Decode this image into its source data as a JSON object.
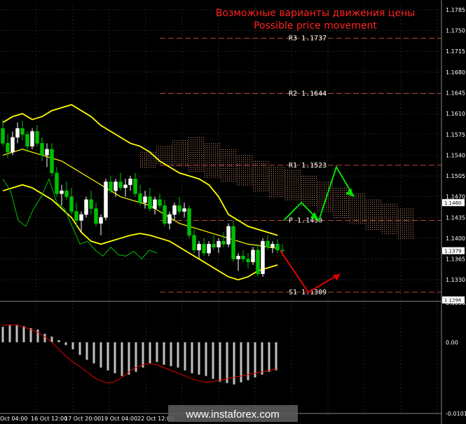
{
  "title_ru": "Возможные варианты движения цены",
  "title_en": "Possible price movement",
  "watermark": "www.instaforex.com",
  "colors": {
    "background": "#000000",
    "grid": "#3a3a3a",
    "level": "#b04a3a",
    "bull": "#ffffff",
    "bear": "#00c000",
    "band": "#ffff00",
    "arrow_up": "#00e000",
    "arrow_down": "#e00000",
    "macd_hist": "#c0c0c0",
    "macd_signal": "#e00000"
  },
  "price_axis": {
    "min": 1.1296,
    "max": 1.1792,
    "ticks": [
      "1.1785",
      "1.1750",
      "1.1715",
      "1.1680",
      "1.1645",
      "1.1610",
      "1.1575",
      "1.1540",
      "1.1505",
      "1.1470",
      "1.1435",
      "1.1400",
      "1.1365",
      "1.1330"
    ],
    "tags": [
      {
        "label": "1.1460",
        "value": 1.146
      },
      {
        "label": "1.1379",
        "value": 1.1379
      },
      {
        "label": "1.1296",
        "value": 1.1296
      }
    ]
  },
  "macd_axis": {
    "min": -0.01013,
    "max": 0.00562,
    "ticks": [
      "0.00562",
      "0.00",
      "-0.01013"
    ]
  },
  "time_axis": [
    "Oct 04:00",
    "16 Oct 12:00",
    "17 Oct 20:00",
    "19 Oct 04:00",
    "22 Oct 12:00"
  ],
  "levels": [
    {
      "label": "R3 1.1737",
      "value": 1.1737
    },
    {
      "label": "R2 1.1644",
      "value": 1.1644
    },
    {
      "label": "R1 1.1523",
      "value": 1.1523
    },
    {
      "label": "P 1.1430",
      "value": 1.143
    },
    {
      "label": "S1 1.1309",
      "value": 1.1309
    }
  ],
  "candles": [
    [
      1.1585,
      1.16,
      1.1555,
      1.156
    ],
    [
      1.156,
      1.1575,
      1.1535,
      1.1545
    ],
    [
      1.1545,
      1.158,
      1.154,
      1.157
    ],
    [
      1.157,
      1.1595,
      1.156,
      1.1585
    ],
    [
      1.1585,
      1.1598,
      1.1565,
      1.1575
    ],
    [
      1.1575,
      1.158,
      1.1545,
      1.1555
    ],
    [
      1.1555,
      1.1585,
      1.155,
      1.158
    ],
    [
      1.158,
      1.159,
      1.1555,
      1.156
    ],
    [
      1.156,
      1.157,
      1.153,
      1.154
    ],
    [
      1.154,
      1.156,
      1.152,
      1.155
    ],
    [
      1.155,
      1.156,
      1.1505,
      1.151
    ],
    [
      1.151,
      1.152,
      1.147,
      1.1475
    ],
    [
      1.1475,
      1.149,
      1.1455,
      1.148
    ],
    [
      1.148,
      1.1495,
      1.1465,
      1.147
    ],
    [
      1.147,
      1.1485,
      1.144,
      1.1445
    ],
    [
      1.1445,
      1.146,
      1.142,
      1.143
    ],
    [
      1.143,
      1.1445,
      1.141,
      1.144
    ],
    [
      1.144,
      1.147,
      1.1435,
      1.1465
    ],
    [
      1.1465,
      1.148,
      1.144,
      1.145
    ],
    [
      1.145,
      1.146,
      1.142,
      1.1425
    ],
    [
      1.1425,
      1.144,
      1.1405,
      1.1435
    ],
    [
      1.1435,
      1.15,
      1.143,
      1.1495
    ],
    [
      1.1495,
      1.1505,
      1.1475,
      1.148
    ],
    [
      1.148,
      1.15,
      1.147,
      1.1495
    ],
    [
      1.1495,
      1.151,
      1.148,
      1.1485
    ],
    [
      1.1485,
      1.15,
      1.147,
      1.149
    ],
    [
      1.149,
      1.1505,
      1.148,
      1.15
    ],
    [
      1.15,
      1.151,
      1.147,
      1.1475
    ],
    [
      1.1475,
      1.149,
      1.1455,
      1.146
    ],
    [
      1.146,
      1.148,
      1.145,
      1.147
    ],
    [
      1.147,
      1.1485,
      1.1445,
      1.145
    ],
    [
      1.145,
      1.147,
      1.144,
      1.1465
    ],
    [
      1.1465,
      1.1475,
      1.145,
      1.1455
    ],
    [
      1.1455,
      1.1465,
      1.142,
      1.1425
    ],
    [
      1.1425,
      1.1445,
      1.1415,
      1.144
    ],
    [
      1.144,
      1.146,
      1.143,
      1.1455
    ],
    [
      1.1455,
      1.147,
      1.144,
      1.1445
    ],
    [
      1.1445,
      1.146,
      1.1435,
      1.145
    ],
    [
      1.145,
      1.1455,
      1.14,
      1.1405
    ],
    [
      1.1405,
      1.1415,
      1.1375,
      1.138
    ],
    [
      1.138,
      1.1395,
      1.1365,
      1.139
    ],
    [
      1.139,
      1.14,
      1.137,
      1.1375
    ],
    [
      1.1375,
      1.1395,
      1.137,
      1.139
    ],
    [
      1.139,
      1.1405,
      1.138,
      1.1385
    ],
    [
      1.1385,
      1.14,
      1.1375,
      1.1395
    ],
    [
      1.1395,
      1.141,
      1.1385,
      1.139
    ],
    [
      1.139,
      1.1425,
      1.1385,
      1.142
    ],
    [
      1.142,
      1.143,
      1.136,
      1.1365
    ],
    [
      1.1365,
      1.1375,
      1.1345,
      1.137
    ],
    [
      1.137,
      1.138,
      1.136,
      1.1365
    ],
    [
      1.1365,
      1.1375,
      1.135,
      1.136
    ],
    [
      1.136,
      1.1385,
      1.1355,
      1.138
    ],
    [
      1.138,
      1.139,
      1.1335,
      1.134
    ],
    [
      1.134,
      1.14,
      1.1335,
      1.1395
    ],
    [
      1.1395,
      1.1405,
      1.138,
      1.1385
    ],
    [
      1.1385,
      1.1395,
      1.1375,
      1.139
    ],
    [
      1.139,
      1.1398,
      1.1375,
      1.138
    ],
    [
      1.138,
      1.139,
      1.137,
      1.1379
    ]
  ],
  "bands": {
    "upper": [
      1.1595,
      1.1605,
      1.161,
      1.16,
      1.1605,
      1.1615,
      1.162,
      1.1625,
      1.1615,
      1.1605,
      1.159,
      1.158,
      1.157,
      1.156,
      1.1555,
      1.1545,
      1.153,
      1.152,
      1.151,
      1.1505,
      1.15,
      1.149,
      1.147,
      1.144,
      1.143,
      1.142,
      1.1415,
      1.141,
      1.1405
    ],
    "mid": [
      1.154,
      1.1545,
      1.155,
      1.1545,
      1.154,
      1.1535,
      1.153,
      1.152,
      1.151,
      1.15,
      1.149,
      1.148,
      1.147,
      1.1465,
      1.146,
      1.1455,
      1.1445,
      1.1435,
      1.1425,
      1.142,
      1.1415,
      1.141,
      1.1405,
      1.14,
      1.1395,
      1.139,
      1.1388,
      1.1385,
      1.1383
    ],
    "lower": [
      1.148,
      1.1485,
      1.149,
      1.1485,
      1.1475,
      1.1465,
      1.145,
      1.1435,
      1.141,
      1.1395,
      1.139,
      1.1395,
      1.14,
      1.1405,
      1.1408,
      1.1405,
      1.14,
      1.1395,
      1.1385,
      1.1375,
      1.1365,
      1.1355,
      1.1345,
      1.1335,
      1.133,
      1.1335,
      1.1345,
      1.135,
      1.1355
    ]
  },
  "chikou": [
    1.15,
    1.148,
    1.143,
    1.142,
    1.145,
    1.147,
    1.15,
    1.146,
    1.145,
    1.142,
    1.139,
    1.1395,
    1.138,
    1.137,
    1.1385,
    1.1372,
    1.137,
    1.1378,
    1.1365,
    1.138,
    1.1375
  ],
  "cloud": [
    {
      "a": 1.1545,
      "b": 1.152
    },
    {
      "a": 1.1555,
      "b": 1.1525
    },
    {
      "a": 1.1565,
      "b": 1.152
    },
    {
      "a": 1.157,
      "b": 1.151
    },
    {
      "a": 1.156,
      "b": 1.15
    },
    {
      "a": 1.155,
      "b": 1.1495
    },
    {
      "a": 1.154,
      "b": 1.1488
    },
    {
      "a": 1.153,
      "b": 1.148
    },
    {
      "a": 1.152,
      "b": 1.147
    },
    {
      "a": 1.1515,
      "b": 1.1462
    },
    {
      "a": 1.1505,
      "b": 1.1455
    },
    {
      "a": 1.1495,
      "b": 1.1445
    },
    {
      "a": 1.1485,
      "b": 1.1435
    },
    {
      "a": 1.1475,
      "b": 1.1425
    },
    {
      "a": 1.1465,
      "b": 1.1415
    },
    {
      "a": 1.1458,
      "b": 1.1405
    },
    {
      "a": 1.145,
      "b": 1.14
    }
  ],
  "scenario_up": [
    1.143,
    1.146,
    1.143,
    1.152,
    1.147
  ],
  "scenario_down": [
    1.1379,
    1.1309,
    1.134
  ],
  "macd": {
    "hist": [
      0.0022,
      0.0024,
      0.0025,
      0.0023,
      0.002,
      0.0018,
      0.0012,
      0.0008,
      0.0003,
      -0.0004,
      -0.001,
      -0.0018,
      -0.0025,
      -0.003,
      -0.0036,
      -0.004,
      -0.0044,
      -0.0048,
      -0.0046,
      -0.0042,
      -0.0036,
      -0.003,
      -0.0028,
      -0.0032,
      -0.0034,
      -0.0036,
      -0.004,
      -0.0044,
      -0.0046,
      -0.0048,
      -0.0052,
      -0.0056,
      -0.0058,
      -0.006,
      -0.0057,
      -0.0054,
      -0.005,
      -0.0046,
      -0.0042,
      -0.004
    ],
    "signal": [
      0.0024,
      0.0025,
      0.0024,
      0.0022,
      0.0018,
      0.0014,
      0.0008,
      0.0,
      -0.001,
      -0.002,
      -0.0028,
      -0.0035,
      -0.0042,
      -0.005,
      -0.0055,
      -0.0058,
      -0.0056,
      -0.005,
      -0.0042,
      -0.0036,
      -0.0032,
      -0.003,
      -0.0032,
      -0.0036,
      -0.004,
      -0.0044,
      -0.0048,
      -0.0052,
      -0.0055,
      -0.0057,
      -0.0056,
      -0.0054,
      -0.0052,
      -0.005,
      -0.0048,
      -0.0046,
      -0.0044,
      -0.0042,
      -0.004,
      -0.0038
    ]
  }
}
